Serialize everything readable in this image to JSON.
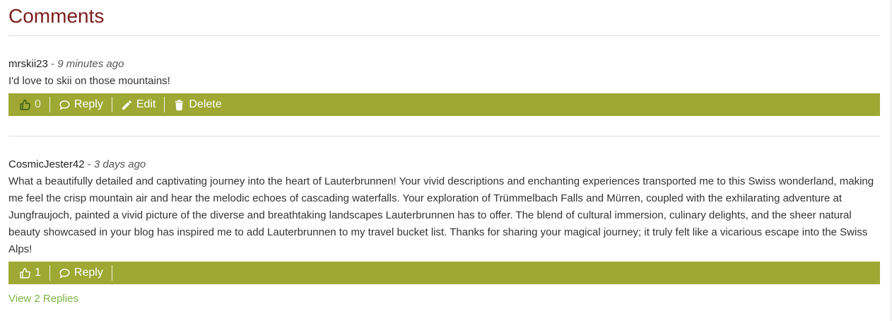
{
  "section": {
    "title": "Comments"
  },
  "comments": [
    {
      "author": "mrskii23",
      "separator": " - ",
      "time": "9 minutes ago",
      "text": "I'd love to skii on those mountains!",
      "likes": "0",
      "reply_label": "Reply",
      "edit_label": "Edit",
      "delete_label": "Delete"
    },
    {
      "author": "CosmicJester42",
      "separator": " - ",
      "time": "3 days ago",
      "text": "What a beautifully detailed and captivating journey into the heart of Lauterbrunnen! Your vivid descriptions and enchanting experiences transported me to this Swiss wonderland, making me feel the crisp mountain air and hear the melodic echoes of cascading waterfalls. Your exploration of Trümmelbach Falls and Mürren, coupled with the exhilarating adventure at Jungfraujoch, painted a vivid picture of the diverse and breathtaking landscapes Lauterbrunnen has to offer. The blend of cultural immersion, culinary delights, and the sheer natural beauty showcased in your blog has inspired me to add Lauterbrunnen to my travel bucket list. Thanks for sharing your magical journey; it truly felt like a vicarious escape into the Swiss Alps!",
      "likes": "1",
      "reply_label": "Reply",
      "view_replies_label": "View 2 Replies"
    }
  ],
  "colors": {
    "title": "#7b1c1c",
    "action_bar": "#9ea833",
    "link": "#7cb342"
  },
  "icons": {
    "like": "thumbs-up-icon",
    "reply": "comment-bubble-icon",
    "edit": "pencil-icon",
    "delete": "trash-icon"
  }
}
